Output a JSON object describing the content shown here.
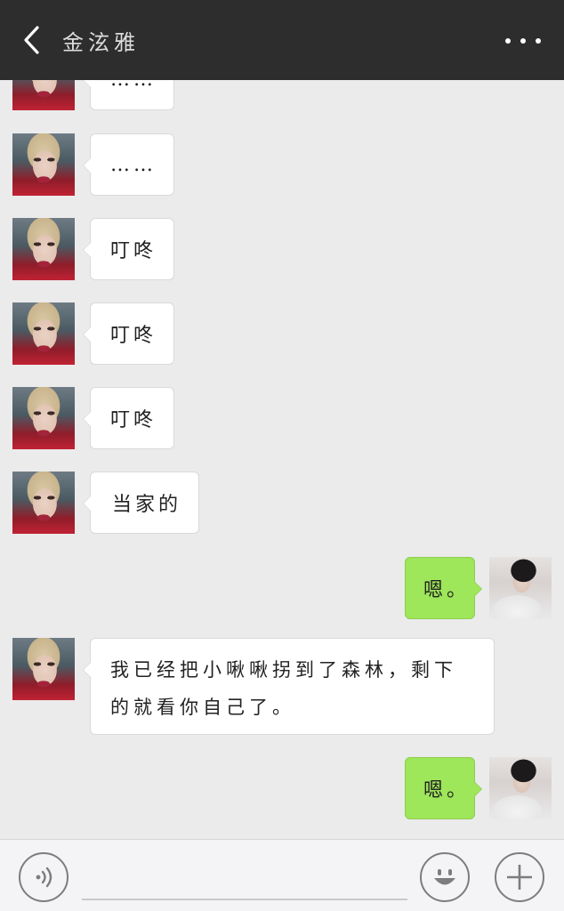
{
  "header": {
    "title": "金泫雅",
    "back_icon": "chevron-left-icon",
    "more_icon": "more-dots-icon"
  },
  "messages": [
    {
      "side": "left",
      "text": "……"
    },
    {
      "side": "left",
      "text": "……"
    },
    {
      "side": "left",
      "text": "叮咚"
    },
    {
      "side": "left",
      "text": "叮咚"
    },
    {
      "side": "left",
      "text": "叮咚"
    },
    {
      "side": "left",
      "text": "当家的"
    },
    {
      "side": "right",
      "text": "嗯。"
    },
    {
      "side": "left",
      "text": "我已经把小啾啾拐到了森林，剩下的就看你自己了。"
    },
    {
      "side": "right",
      "text": "嗯。"
    }
  ],
  "input_bar": {
    "voice_icon": "voice-icon",
    "emoji_icon": "emoji-icon",
    "plus_icon": "plus-icon",
    "input_value": ""
  },
  "colors": {
    "header_bg": "#2d2d2d",
    "chat_bg": "#ebebeb",
    "sent_bubble": "#9ee65a",
    "received_bubble": "#ffffff"
  }
}
